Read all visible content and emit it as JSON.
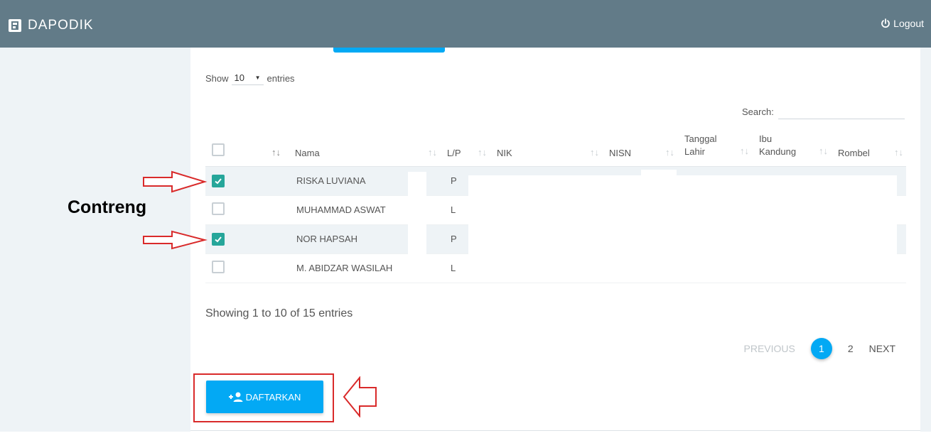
{
  "app": {
    "brand": "DAPODIK",
    "logout_label": "Logout"
  },
  "controls": {
    "show_label": "Show",
    "length_value": "10",
    "entries_label": "entries",
    "search_label": "Search:",
    "search_value": ""
  },
  "table": {
    "columns": [
      "Nama",
      "L/P",
      "NIK",
      "NISN",
      "Tanggal Lahir",
      "Ibu Kandung",
      "Rombel"
    ],
    "column_nama": "Nama",
    "column_lp": "L/P",
    "column_nik": "NIK",
    "column_nisn": "NISN",
    "column_tanggal_line1": "Tanggal",
    "column_tanggal_line2": "Lahir",
    "column_ibu_line1": "Ibu",
    "column_ibu_line2": "Kandung",
    "column_rombel": "Rombel",
    "rows": [
      {
        "nama": "RISKA LUVIANA",
        "lp": "P",
        "checked": true
      },
      {
        "nama": "MUHAMMAD ASWAT",
        "lp": "L",
        "checked": false
      },
      {
        "nama": "NOR HAPSAH",
        "lp": "P",
        "checked": true
      },
      {
        "nama": "M. ABIDZAR WASILAH",
        "lp": "L",
        "checked": false
      }
    ]
  },
  "info": "Showing 1 to 10 of 15 entries",
  "pagination": {
    "previous": "PREVIOUS",
    "pages": [
      "1",
      "2"
    ],
    "current": "1",
    "next": "NEXT"
  },
  "action": {
    "daftarkan_label": "DAFTARKAN"
  },
  "annotation": {
    "label": "Contreng",
    "color": "#d92a2a"
  },
  "colors": {
    "topbar": "#627b88",
    "accent": "#03a9f4",
    "checkbox": "#26a69a"
  }
}
